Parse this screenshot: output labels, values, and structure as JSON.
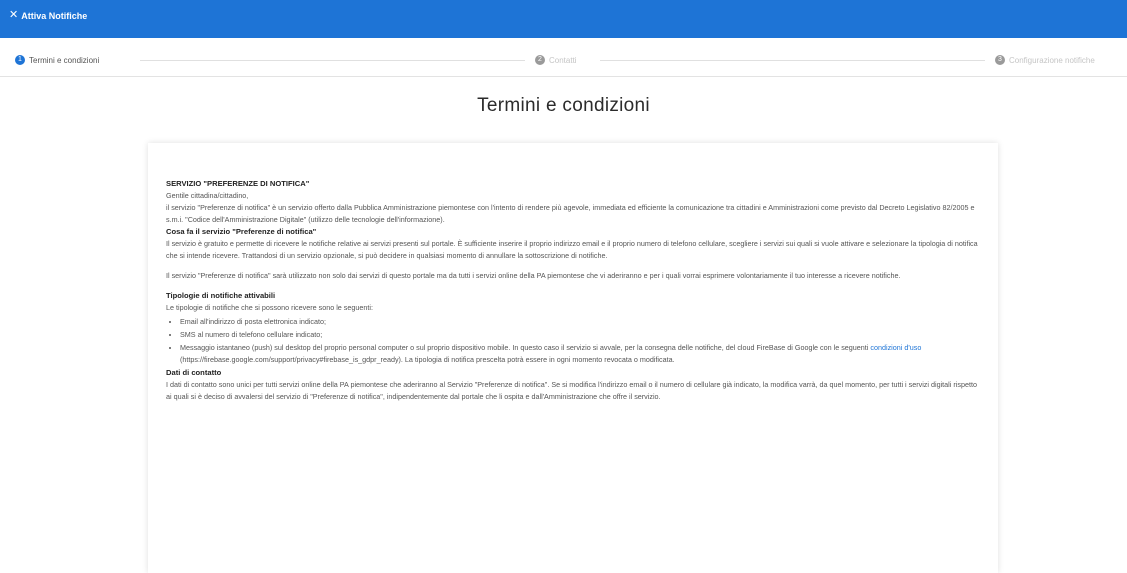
{
  "window": {
    "close_icon": "close-icon",
    "title": "Attiva Notifiche"
  },
  "stepper": {
    "steps": [
      {
        "number": "1",
        "label": "Termini e condizioni",
        "state": "active"
      },
      {
        "number": "2",
        "label": "Contatti",
        "state": "inactive"
      },
      {
        "number": "3",
        "label": "Configurazione notifiche",
        "state": "inactive"
      }
    ]
  },
  "page": {
    "title": "Termini e condizioni"
  },
  "terms": {
    "heading": "SERVIZIO \"PREFERENZE DI NOTIFICA\"",
    "greeting": "Gentile cittadina/cittadino,",
    "intro": "il servizio \"Preferenze di notifica\" è un servizio offerto dalla Pubblica Amministrazione piemontese con l'intento di rendere più agevole, immediata ed efficiente la comunicazione tra cittadini e Amministrazioni come previsto dal Decreto Legislativo 82/2005 e s.m.i. \"Codice dell'Amministrazione Digitale\" (utilizzo delle tecnologie dell'informazione).",
    "what_title": "Cosa fa il servizio \"Preferenze di notifica\"",
    "what_text": "Il servizio è gratuito e permette di ricevere le notifiche relative ai servizi presenti sul portale. È sufficiente inserire il proprio indirizzo email e il proprio numero di telefono cellulare, scegliere i servizi sui quali si vuole attivare e selezionare la tipologia di notifica che si intende ricevere. Trattandosi di un servizio opzionale, si può decidere in qualsiasi momento di annullare la sottoscrizione di notifiche.",
    "usage_text": "Il servizio \"Preferenze di notifica\" sarà utilizzato non solo dai servizi di questo portale ma da tutti i servizi online della PA piemontese che vi aderiranno e per i quali vorrai esprimere volontariamente il tuo interesse a ricevere notifiche.",
    "types_title": "Tipologie di notifiche attivabili",
    "types_intro": "Le tipologie di notifiche che si possono ricevere sono le seguenti:",
    "types_items": [
      "Email all'indirizzo di posta elettronica indicato;",
      "SMS al numero di telefono cellulare indicato;"
    ],
    "push_item_before": "Messaggio istantaneo (push) sul desktop del proprio personal computer o sul proprio dispositivo mobile. In questo caso il servizio si avvale, per la consegna delle notifiche, del cloud FireBase di Google con le seguenti ",
    "push_item_link": "condizioni d'uso",
    "push_item_after": " (https://firebase.google.com/support/privacy#firebase_is_gdpr_ready). La tipologia di notifica prescelta potrà essere in ogni momento revocata o modificata.",
    "contacts_title": "Dati di contatto",
    "contacts_text": "I dati di contatto sono unici per tutti servizi online della PA piemontese che aderiranno al Servizio \"Preferenze di notifica\". Se si modifica l'indirizzo email o il numero di cellulare già indicato, la modifica varrà, da quel momento, per tutti i servizi digitali rispetto ai quali si è deciso di avvalersi del servizio di \"Preferenze di notifica\", indipendentemente dal portale che li ospita e dall'Amministrazione che offre il servizio."
  },
  "colors": {
    "accent": "#1e74d6",
    "inactive_step": "#9a9a9a"
  }
}
